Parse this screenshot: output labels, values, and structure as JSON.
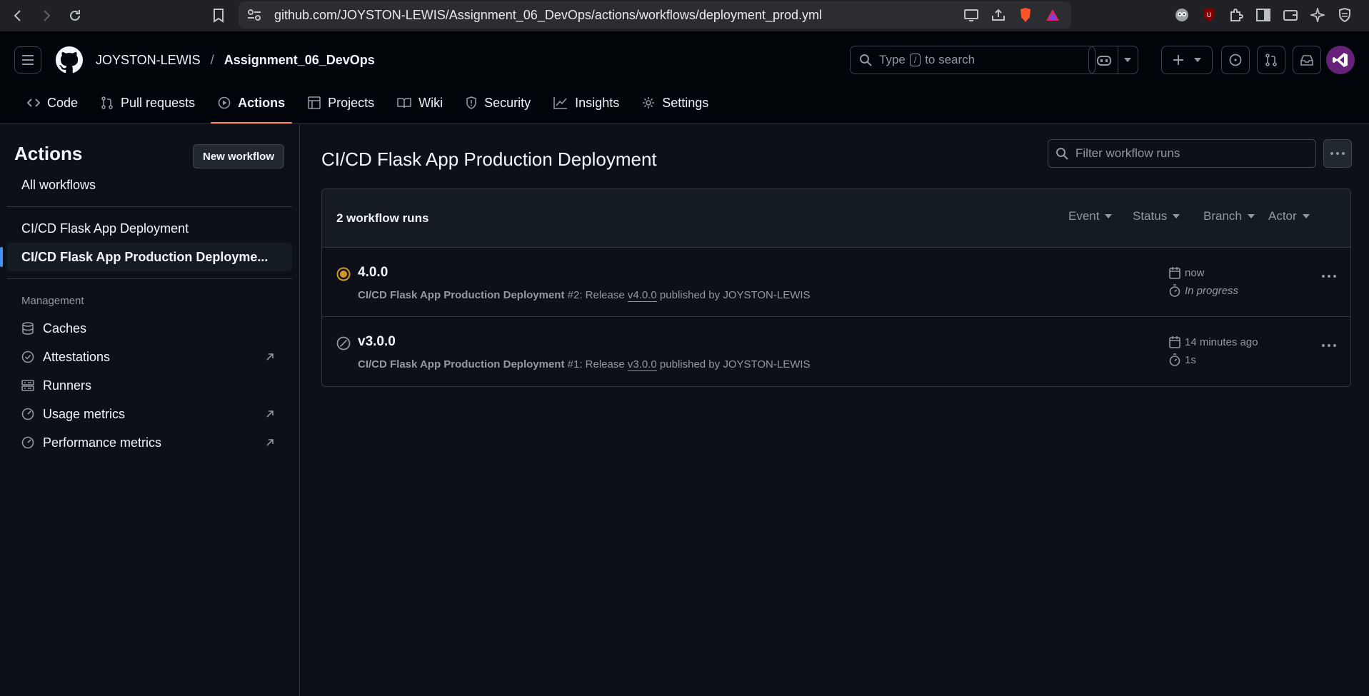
{
  "browser": {
    "url": "github.com/JOYSTON-LEWIS/Assignment_06_DevOps/actions/workflows/deployment_prod.yml"
  },
  "header": {
    "owner": "JOYSTON-LEWIS",
    "separator": "/",
    "repo": "Assignment_06_DevOps",
    "search_prefix": "Type",
    "search_key": "/",
    "search_suffix": "to search"
  },
  "tabs": [
    {
      "label": "Code",
      "icon": "code-icon"
    },
    {
      "label": "Pull requests",
      "icon": "pull-request-icon"
    },
    {
      "label": "Actions",
      "icon": "play-icon"
    },
    {
      "label": "Projects",
      "icon": "table-icon"
    },
    {
      "label": "Wiki",
      "icon": "book-icon"
    },
    {
      "label": "Security",
      "icon": "shield-icon"
    },
    {
      "label": "Insights",
      "icon": "graph-icon"
    },
    {
      "label": "Settings",
      "icon": "gear-icon"
    }
  ],
  "sidebar": {
    "title": "Actions",
    "new_workflow": "New workflow",
    "all_workflows": "All workflows",
    "workflows": [
      "CI/CD Flask App Deployment",
      "CI/CD Flask App Production Deployme..."
    ],
    "management_heading": "Management",
    "management": [
      "Caches",
      "Attestations",
      "Runners",
      "Usage metrics",
      "Performance metrics"
    ]
  },
  "main": {
    "title": "CI/CD Flask App Production Deployment",
    "filter_placeholder": "Filter workflow runs",
    "runs_count": "2 workflow runs",
    "filters": [
      "Event",
      "Status",
      "Branch",
      "Actor"
    ],
    "runs": [
      {
        "title": "4.0.0",
        "status": "in_progress",
        "workflow": "CI/CD Flask App Production Deployment",
        "mid": "#2: Release",
        "tag": "v4.0.0",
        "tail": "published by JOYSTON-LEWIS",
        "when": "now",
        "duration": "In progress"
      },
      {
        "title": "v3.0.0",
        "status": "cancelled",
        "workflow": "CI/CD Flask App Production Deployment",
        "mid": "#1: Release",
        "tag": "v3.0.0",
        "tail": "published by JOYSTON-LEWIS",
        "when": "14 minutes ago",
        "duration": "1s"
      }
    ]
  },
  "colors": {
    "accent_underline": "#f78166",
    "selected_bar": "#4493f8",
    "in_progress": "#d29922",
    "avatar_bg": "#68217a"
  }
}
